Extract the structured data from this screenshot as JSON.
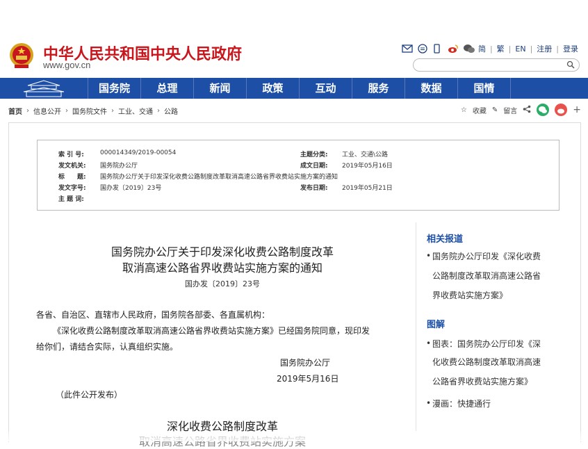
{
  "header": {
    "title": "中华人民共和国中央人民政府",
    "url": "www.gov.cn",
    "toolbar": {
      "simplified": "简",
      "traditional": "繁",
      "english": "EN",
      "register": "注册",
      "login": "登录"
    }
  },
  "nav": [
    "国务院",
    "总理",
    "新闻",
    "政策",
    "互动",
    "服务",
    "数据",
    "国情"
  ],
  "breadcrumb": [
    "首页",
    "信息公开",
    "国务院文件",
    "工业、交通",
    "公路"
  ],
  "page_tools": {
    "favorite": "收藏",
    "comment": "留言"
  },
  "meta": {
    "index_label": "索 引 号:",
    "index": "000014349/2019-00054",
    "topic_label": "主题分类:",
    "topic": "工业、交通\\公路",
    "issuer_label": "发文机关:",
    "issuer": "国务院办公厅",
    "created_label": "成文日期:",
    "created": "2019年05月16日",
    "title_label": "标　　题:",
    "title": "国务院办公厅关于印发深化收费公路制度改革取消高速公路省界收费站实施方案的通知",
    "docno_label": "发文字号:",
    "docno": "国办发〔2019〕23号",
    "published_label": "发布日期:",
    "published": "2019年05月21日",
    "keywords_label": "主 题 词:"
  },
  "document": {
    "title_line1": "国务院办公厅关于印发深化收费公路制度改革",
    "title_line2": "取消高速公路省界收费站实施方案的通知",
    "doc_no": "国办发〔2019〕23号",
    "recipients": "各省、自治区、直辖市人民政府，国务院各部委、各直属机构：",
    "para1_line1": "《深化收费公路制度改革取消高速公路省界收费站实施方案》已经国务院同意，现印发",
    "para1_line2": "给你们，请结合实际，认真组织实施。",
    "signer": "国务院办公厅",
    "date": "2019年5月16日",
    "note": "（此件公开发布）",
    "sub_title1": "深化收费公路制度改革",
    "sub_title2": "取消高速公路省界收费站实施方案"
  },
  "sidebar": {
    "related_heading": "相关报道",
    "related_lines": [
      "国务院办公厅印发《深化收费",
      "公路制度改革取消高速公路省",
      "界收费站实施方案》"
    ],
    "graphics_heading": "图解",
    "graphics_lines": [
      "图表：国务院办公厅印发《深",
      "化收费公路制度改革取消高速",
      "公路省界收费站实施方案》"
    ],
    "comic": "漫画：快捷通行"
  },
  "colors": {
    "brand_red": "#c8161d",
    "nav_blue": "#1c4fa5"
  }
}
